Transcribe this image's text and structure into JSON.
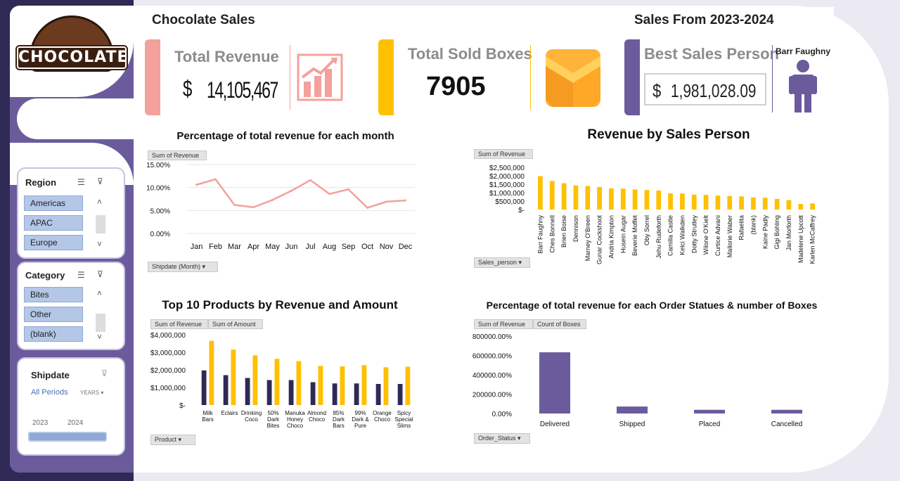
{
  "header": {
    "title": "Chocolate Sales",
    "range": "Sales  From 2023-2024"
  },
  "logo": {
    "text": "CHOCOLATE"
  },
  "kpi": {
    "revenue_label": "Total Revenue",
    "revenue_currency": "$",
    "revenue_value": "14,105,467",
    "boxes_label": "Total Sold Boxes",
    "boxes_value": "7905",
    "best_label": "Best Sales Person",
    "best_name": "Barr Faughny",
    "best_currency": "$",
    "best_value": "1,981,028.09"
  },
  "colors": {
    "accent_purple": "#6b5b9d",
    "accent_yellow": "#ffc000",
    "accent_pink": "#f4a09c",
    "bar_dark": "#2e2a55"
  },
  "slicers": {
    "region": {
      "title": "Region",
      "items": [
        "Americas",
        "APAC",
        "Europe"
      ]
    },
    "category": {
      "title": "Category",
      "items": [
        "Bites",
        "Other",
        "(blank)"
      ]
    },
    "shipdate": {
      "title": "Shipdate",
      "all": "All Periods",
      "unit": "YEARS",
      "years": [
        "2023",
        "2024"
      ]
    }
  },
  "month_chart": {
    "title": "Percentage of total revenue for each month",
    "field": "Sum of Revenue",
    "axis_button": "Shipdate (Month)",
    "y_ticks": [
      "15.00%",
      "10.00%",
      "5.00%",
      "0.00%"
    ]
  },
  "sales_chart": {
    "title": "Revenue by Sales Person",
    "field": "Sum of Revenue",
    "axis_button": "Sales_person",
    "y_ticks": [
      "$2,500,000",
      "$2,000,000",
      "$1,500,000",
      "$1,000,000",
      "$500,000",
      "$-"
    ]
  },
  "products_chart": {
    "title": "Top 10 Products by Revenue and Amount",
    "fields": [
      "Sum of Revenue",
      "Sum of Amount"
    ],
    "axis_button": "Product",
    "y_ticks": [
      "$4,000,000",
      "$3,000,000",
      "$2,000,000",
      "$1,000,000",
      "$-"
    ]
  },
  "status_chart": {
    "title": "Percentage of total revenue for each  Order Statues & number of Boxes",
    "fields": [
      "Sum of Revenue",
      "Count of Boxes"
    ],
    "axis_button": "Order_Status",
    "y_ticks": [
      "800000.00%",
      "600000.00%",
      "400000.00%",
      "200000.00%",
      "0.00%"
    ]
  },
  "chart_data": [
    {
      "type": "line",
      "title": "Percentage of total revenue for each month",
      "categories": [
        "Jan",
        "Feb",
        "Mar",
        "Apr",
        "May",
        "Jun",
        "Jul",
        "Aug",
        "Sep",
        "Oct",
        "Nov",
        "Dec"
      ],
      "values": [
        10.6,
        11.8,
        6.2,
        5.7,
        7.3,
        9.3,
        11.6,
        8.6,
        9.6,
        5.6,
        6.9,
        7.2
      ],
      "ylim": [
        0,
        15
      ],
      "color": "#f4a09c"
    },
    {
      "type": "bar",
      "title": "Revenue by Sales Person",
      "categories": [
        "Barr Faughny",
        "Ches Bonnell",
        "Brien Boise",
        "Dennison",
        "Marney O'Breen",
        "Gunar Cockshoot",
        "Andria Kimpton",
        "Husein Augar",
        "Beverie Moffet",
        "Oby Sorrel",
        "Jehu Rudeforth",
        "Camilla Castle",
        "Kelci Walkden",
        "Dotty Strutley",
        "Wilone O'Kielt",
        "Curtice Advani",
        "Mallorie Waber",
        "Rafaelita",
        "(blank)",
        "Kaine Padly",
        "Gigi Bohling",
        "Jan Morforth",
        "Madelene Upcott",
        "Karlen McCaffrey"
      ],
      "values": [
        1981028,
        1690000,
        1560000,
        1430000,
        1400000,
        1340000,
        1260000,
        1240000,
        1190000,
        1160000,
        1130000,
        960000,
        950000,
        880000,
        870000,
        830000,
        800000,
        780000,
        720000,
        700000,
        630000,
        560000,
        330000,
        360000
      ],
      "ylim": [
        0,
        2500000
      ],
      "color": "#ffc000"
    },
    {
      "type": "bar",
      "title": "Top 10 Products by Revenue and Amount",
      "categories": [
        "Milk Bars",
        "Eclairs",
        "Drinking Coco",
        "50% Dark Bites",
        "Manuka Honey Choco",
        "Almond Choco",
        "85% Dark Bars",
        "99% Dark & Pure",
        "Orange Choco",
        "Spicy Special Slims"
      ],
      "series": [
        {
          "name": "Sum of Revenue",
          "values": [
            1970000,
            1700000,
            1540000,
            1420000,
            1420000,
            1300000,
            1230000,
            1230000,
            1200000,
            1200000
          ],
          "color": "#2e2a55"
        },
        {
          "name": "Sum of Amount",
          "values": [
            3650000,
            3150000,
            2830000,
            2630000,
            2500000,
            2230000,
            2200000,
            2270000,
            2150000,
            2180000
          ],
          "color": "#ffc000"
        }
      ],
      "ylim": [
        0,
        4000000
      ]
    },
    {
      "type": "bar",
      "title": "Percentage of total revenue for each  Order Statues & number of Boxes",
      "categories": [
        "Delivered",
        "Shipped",
        "Placed",
        "Cancelled"
      ],
      "values": [
        633000,
        72000,
        38000,
        38000
      ],
      "ylim": [
        0,
        800000
      ],
      "color": "#6b5b9d"
    }
  ]
}
